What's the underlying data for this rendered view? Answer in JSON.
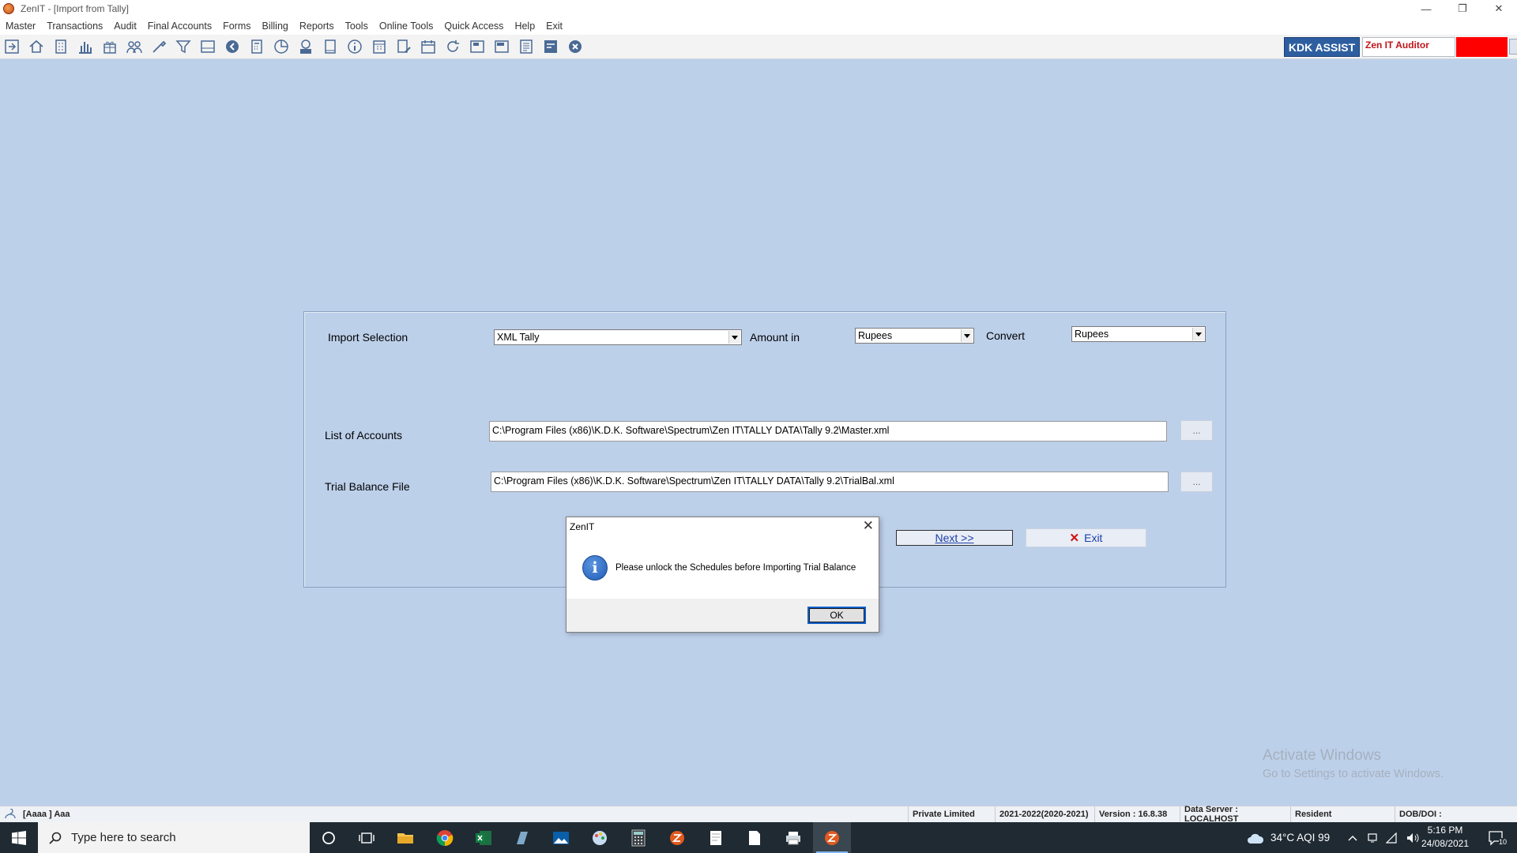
{
  "window": {
    "title": "ZenIT - [Import from Tally]",
    "minimize": "—",
    "restore": "❐",
    "close": "✕"
  },
  "menu": [
    "Master",
    "Transactions",
    "Audit",
    "Final Accounts",
    "Forms",
    "Billing",
    "Reports",
    "Tools",
    "Online Tools",
    "Quick Access",
    "Help",
    "Exit"
  ],
  "toolbar": {
    "icons": [
      "import-icon",
      "home-icon",
      "building-icon",
      "bar-chart-icon",
      "gift-icon",
      "people-icon",
      "tools-icon",
      "filter-icon",
      "tax-icon",
      "back-circle-icon",
      "calculator-icon",
      "pie-icon",
      "pay-icon",
      "book-icon",
      "info-icon",
      "calendar-grid-icon",
      "document-edit-icon",
      "calendar-icon",
      "refresh-icon",
      "balance-sheet-icon",
      "3cd-icon",
      "report-icon",
      "fac-icon",
      "close-circle-icon"
    ],
    "kdk_assist": "KDK ASSIST",
    "auditor": "Zen IT Auditor"
  },
  "form": {
    "import_selection_label": "Import Selection",
    "import_selection_value": "XML Tally",
    "amount_in_label": "Amount in",
    "amount_in_value": "Rupees",
    "convert_label": "Convert",
    "convert_value": "Rupees",
    "accounts_label": "List of Accounts",
    "accounts_path": "C:\\Program Files (x86)\\K.D.K. Software\\Spectrum\\Zen IT\\TALLY DATA\\Tally 9.2\\Master.xml",
    "trial_label": "Trial Balance File",
    "trial_path": "C:\\Program Files (x86)\\K.D.K. Software\\Spectrum\\Zen IT\\TALLY DATA\\Tally 9.2\\TrialBal.xml",
    "browse": "...",
    "next": "Next  >>",
    "exit": "Exit"
  },
  "dialog": {
    "title": "ZenIT",
    "message": "Please unlock the Schedules before Importing Trial Balance",
    "ok": "OK",
    "close": "✕",
    "info": "i"
  },
  "watermark": {
    "line1": "Activate Windows",
    "line2": "Go to Settings to activate Windows."
  },
  "status": {
    "user": "[Aaaa ] Aaa",
    "entity": "Private Limited",
    "year": "2021-2022(2020-2021)",
    "version": "Version : 16.8.38",
    "server": "Data Server : LOCALHOST",
    "residency": "Resident",
    "dob": "DOB/DOI :"
  },
  "taskbar": {
    "search_placeholder": "Type here to search",
    "apps": [
      "cortana-icon",
      "task-view-icon",
      "file-explorer-icon",
      "chrome-icon",
      "excel-icon",
      "app-icon",
      "photos-icon",
      "paint-icon",
      "calculator-icon",
      "zenit-icon",
      "notepad-icon",
      "document-icon",
      "printer-icon",
      "zenit-active-icon"
    ],
    "weather": "34°C  AQI 99",
    "time": "5:16 PM",
    "date": "24/08/2021",
    "notifications": "10"
  },
  "colors": {
    "background": "#bdd0ea",
    "kdk_assist": "#2d5ea0",
    "auditor_text": "#c0141b",
    "alert_red": "#ff0000",
    "link_blue": "#1a3fa8",
    "taskbar": "#1f2a33"
  }
}
